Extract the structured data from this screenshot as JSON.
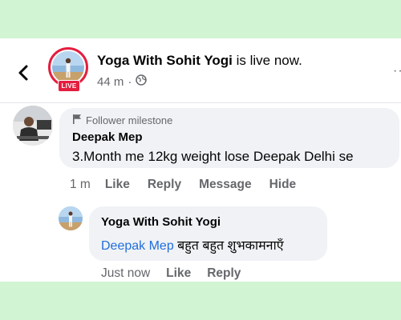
{
  "post": {
    "page_name": "Yoga With Sohit Yogi",
    "status_text": " is live now.",
    "time": "44 m",
    "separator": "·",
    "live_label": "LIVE"
  },
  "icons": {
    "back": "back-arrow-icon",
    "globe": "globe-icon",
    "more": "more-icon",
    "flag": "flag-icon"
  },
  "comment": {
    "badge": "Follower milestone",
    "author": "Deepak Mep",
    "text": "3.Month me 12kg weight lose Deepak Delhi se",
    "time": "1 m",
    "actions": [
      "Like",
      "Reply",
      "Message",
      "Hide"
    ]
  },
  "reply": {
    "author": "Yoga With Sohit Yogi",
    "mention": "Deepak Mep",
    "text": " बहुत बहुत शुभकामनाएँ",
    "time": "Just now",
    "actions": [
      "Like",
      "Reply"
    ]
  },
  "colors": {
    "background": "#d1f5d3",
    "live_red": "#e41e3f",
    "mention_blue": "#216fdb",
    "bubble": "#f0f2f5",
    "secondary_text": "#65676b"
  }
}
